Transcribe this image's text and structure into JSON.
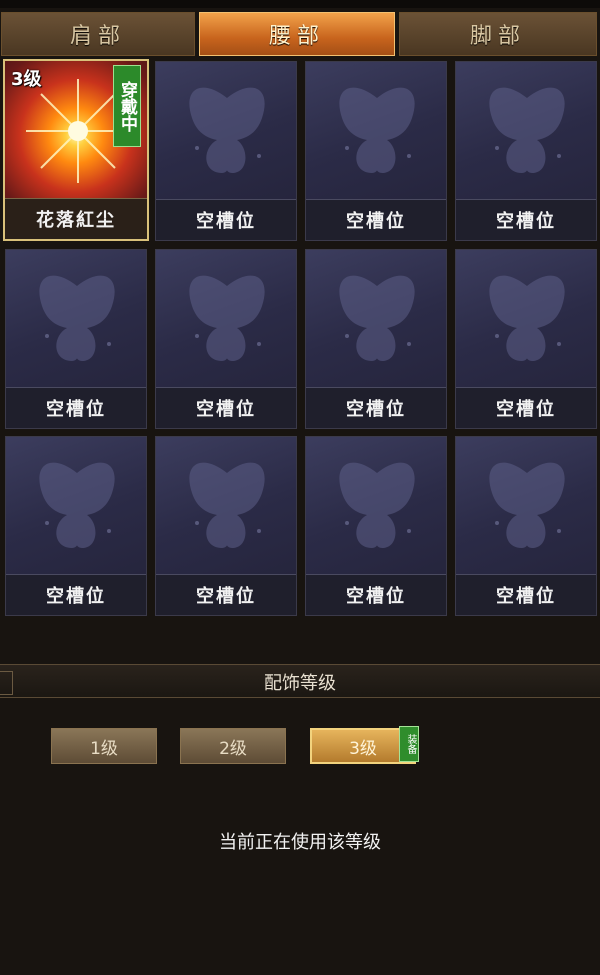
{
  "tabs": [
    {
      "label": "肩部",
      "active": false
    },
    {
      "label": "腰部",
      "active": true
    },
    {
      "label": "脚部",
      "active": false
    }
  ],
  "slots": [
    {
      "label": "花落紅尘",
      "level": "3级",
      "status": "穿戴中",
      "equipped": true
    },
    {
      "label": "空槽位"
    },
    {
      "label": "空槽位"
    },
    {
      "label": "空槽位"
    },
    {
      "label": "空槽位"
    },
    {
      "label": "空槽位"
    },
    {
      "label": "空槽位"
    },
    {
      "label": "空槽位"
    },
    {
      "label": "空槽位"
    },
    {
      "label": "空槽位"
    },
    {
      "label": "空槽位"
    },
    {
      "label": "空槽位"
    }
  ],
  "level_section": {
    "title": "配饰等级",
    "buttons": [
      {
        "label": "1级",
        "active": false
      },
      {
        "label": "2级",
        "active": false
      },
      {
        "label": "3级",
        "active": true
      }
    ],
    "equip_badge": "装备",
    "status_text": "当前正在使用该等级"
  },
  "colors": {
    "active_tab": "#d8782a",
    "equipped_badge": "#2c8a2a",
    "slot_bg": "#2b2b47"
  },
  "icons": {
    "empty_slot": "butterfly-icon",
    "equipped_item": "sunburst-icon"
  }
}
